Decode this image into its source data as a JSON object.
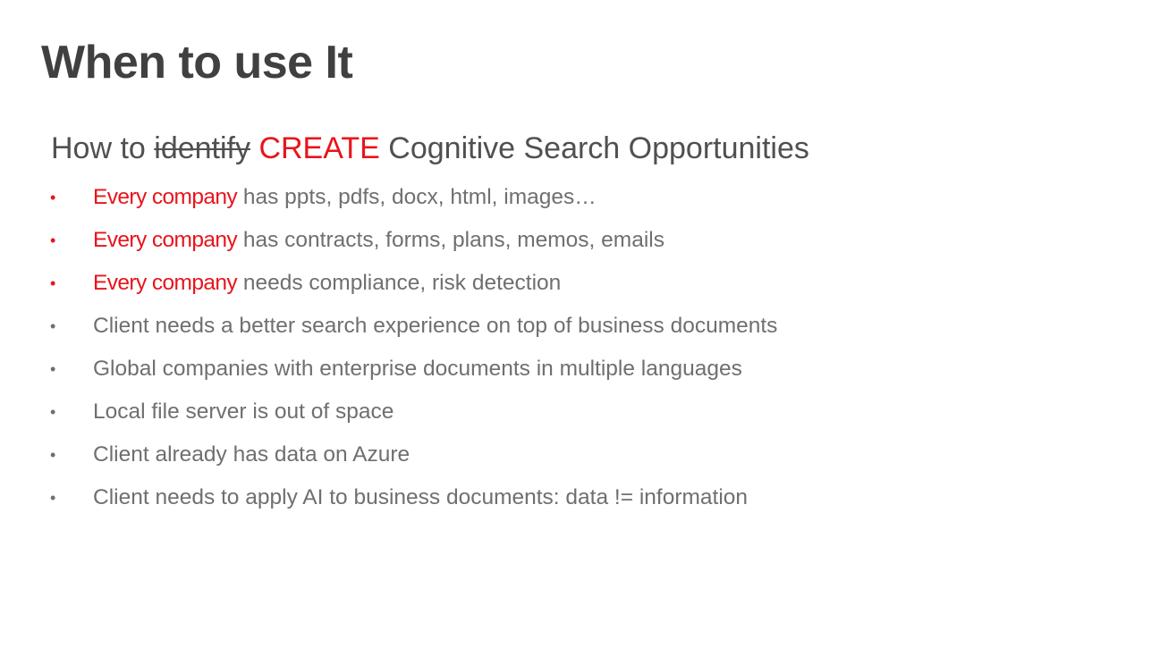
{
  "slide": {
    "title": "When to use It",
    "subtitle": {
      "prefix": "How to ",
      "struck": "identify",
      "highlight": "CREATE",
      "suffix": "Cognitive Search  Opportunities"
    },
    "bullets": [
      {
        "emphasis": "Every company",
        "text": "has ppts, pdfs, docx, html, images…"
      },
      {
        "emphasis": "Every company",
        "text": "has contracts, forms, plans, memos, emails"
      },
      {
        "emphasis": "Every company",
        "text": "needs compliance, risk detection"
      },
      {
        "emphasis": "",
        "text": "Client needs a better search experience on top of business documents"
      },
      {
        "emphasis": "",
        "text": "Global companies with enterprise documents in multiple languages"
      },
      {
        "emphasis": "",
        "text": "Local file server is out of space"
      },
      {
        "emphasis": "",
        "text": "Client already has data on Azure"
      },
      {
        "emphasis": "",
        "text": "Client needs to apply AI to business documents: data != information"
      }
    ],
    "bullet_glyph": "•",
    "colors": {
      "accent": "#e8141b",
      "title": "#404040",
      "body": "#6f6f6f"
    }
  }
}
